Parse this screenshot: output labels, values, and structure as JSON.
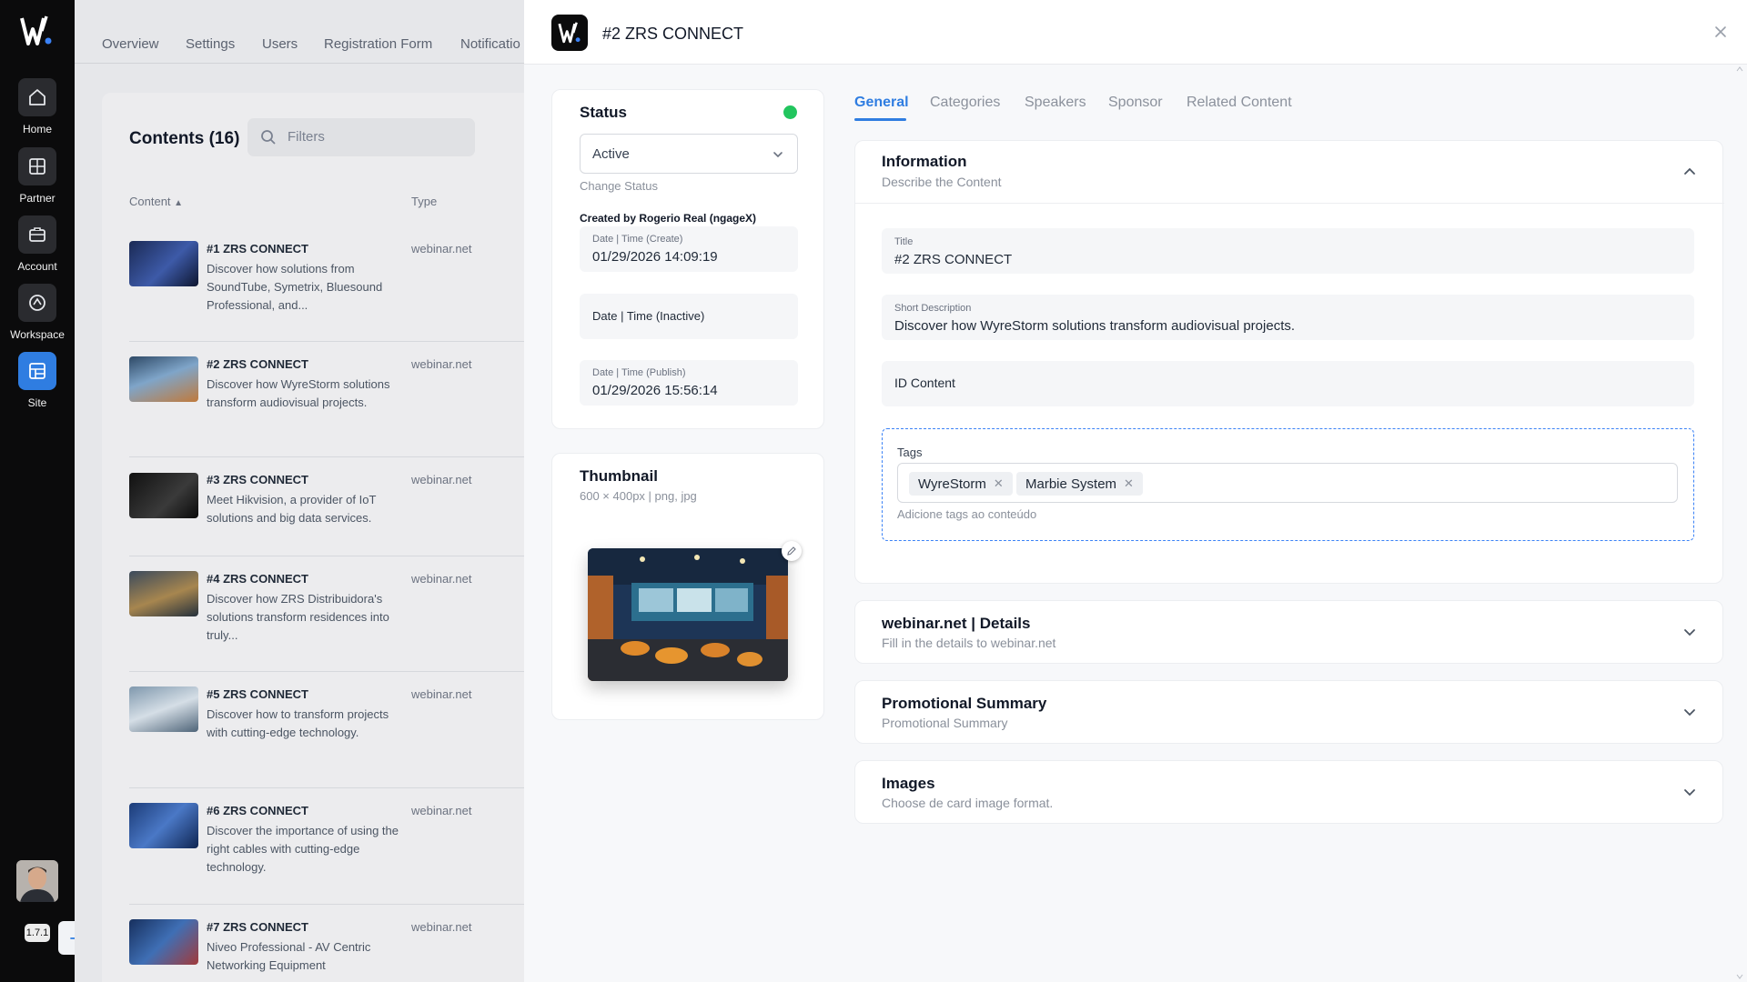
{
  "rail": {
    "items": [
      {
        "label": "Home",
        "icon": "home-icon"
      },
      {
        "label": "Partner",
        "icon": "partner-icon"
      },
      {
        "label": "Account",
        "icon": "briefcase-icon"
      },
      {
        "label": "Workspace",
        "icon": "workspace-icon"
      },
      {
        "label": "Site",
        "icon": "layout-icon"
      }
    ],
    "version": "1.7.1"
  },
  "background": {
    "tabs": [
      "Overview",
      "Settings",
      "Users",
      "Registration Form",
      "Notificatio"
    ],
    "title": "Contents (16)",
    "filter_placeholder": "Filters",
    "columns": [
      "Content",
      "Type"
    ],
    "rows": [
      {
        "title": "#1 ZRS CONNECT",
        "desc": "Discover how solutions from SoundTube, Symetrix, Bluesound Professional, and...",
        "type": "webinar.net"
      },
      {
        "title": "#2 ZRS CONNECT",
        "desc": "Discover how WyreStorm solutions transform audiovisual projects.",
        "type": "webinar.net"
      },
      {
        "title": "#3 ZRS CONNECT",
        "desc": "Meet Hikvision, a provider of IoT solutions and big data services.",
        "type": "webinar.net"
      },
      {
        "title": "#4 ZRS CONNECT",
        "desc": "Discover how ZRS Distribuidora's solutions transform residences into truly...",
        "type": "webinar.net"
      },
      {
        "title": "#5 ZRS CONNECT",
        "desc": "Discover how to transform projects with cutting-edge technology.",
        "type": "webinar.net"
      },
      {
        "title": "#6 ZRS CONNECT",
        "desc": "Discover the importance of using the right cables with cutting-edge technology.",
        "type": "webinar.net"
      },
      {
        "title": "#7 ZRS CONNECT",
        "desc": "Niveo Professional - AV Centric Networking Equipment",
        "type": "webinar.net"
      }
    ]
  },
  "drawer": {
    "title": "#2 ZRS CONNECT",
    "status": {
      "title": "Status",
      "value": "Active",
      "hint": "Change Status",
      "created_by": "Created by Rogerio Real (ngageX)",
      "create_label": "Date | Time (Create)",
      "create_value": "01/29/2026 14:09:19",
      "inactive_label": "Date | Time (Inactive)",
      "publish_label": "Date | Time (Publish)",
      "publish_value": "01/29/2026 15:56:14",
      "indicator_color": "#22c55e"
    },
    "thumbnail": {
      "title": "Thumbnail",
      "hint": "600 × 400px | png, jpg"
    },
    "tabs": [
      "General",
      "Categories",
      "Speakers",
      "Sponsor",
      "Related Content"
    ],
    "active_tab": "General",
    "information": {
      "title": "Information",
      "subtitle": "Describe the Content",
      "title_label": "Title",
      "title_value": "#2 ZRS CONNECT",
      "short_desc_label": "Short Description",
      "short_desc_value": "Discover how WyreStorm solutions transform audiovisual projects.",
      "id_label": "ID Content",
      "tags_label": "Tags",
      "tags": [
        "WyreStorm",
        "Marbie System"
      ],
      "tags_hint": "Adicione tags ao conteúdo"
    },
    "sections": [
      {
        "title": "webinar.net | Details",
        "subtitle": "Fill in the details to webinar.net"
      },
      {
        "title": "Promotional Summary",
        "subtitle": "Promotional Summary"
      },
      {
        "title": "Images",
        "subtitle": "Choose de card image format."
      }
    ],
    "accent_color": "#2f7de1"
  }
}
